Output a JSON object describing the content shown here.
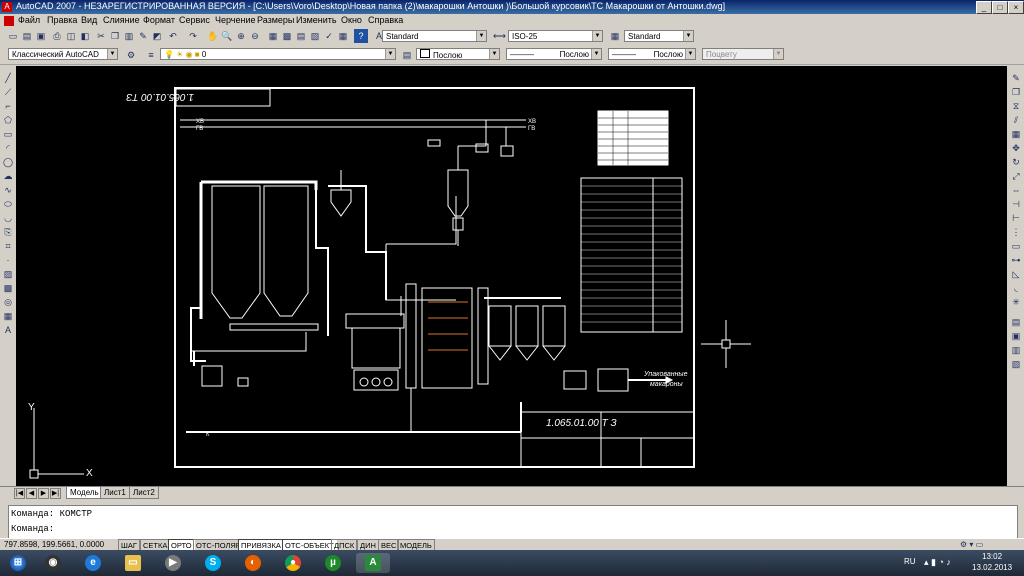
{
  "window": {
    "title": "AutoCAD 2007 - НЕЗАРЕГИСТРИРОВАННАЯ ВЕРСИЯ - [C:\\Users\\Voro\\Desktop\\Новая папка (2)\\макарошки Антошки )\\Большой курсовик\\ТС Макарошки от Антошки.dwg]",
    "minimize": "_",
    "maximize": "□",
    "close": "×"
  },
  "menu": [
    "Файл",
    "Правка",
    "Вид",
    "Слияние",
    "Формат",
    "Сервис",
    "Черчение",
    "Размеры",
    "Изменить",
    "Окно",
    "Справка"
  ],
  "toolbar": {
    "text_style": "Standard",
    "dim_style": "ISO-25",
    "table_style": "Standard",
    "workspace": "Классический AutoCAD",
    "layer": "0",
    "color": "Послою",
    "linetype": "Послою",
    "lineweight": "Послою",
    "plotstyle": "Поцвету"
  },
  "drawing": {
    "title_code_top": "1.065.01.00 ТЗ",
    "title_code_stamp": "1.065.01.00  Т З",
    "pipe_labels": [
      "ХВ",
      "ГВ",
      "К",
      "ХВ",
      "ГВ"
    ],
    "output_label_1": "Упакованные",
    "output_label_2": "макароны"
  },
  "tabs": {
    "model": "Модель",
    "sheet1": "Лист1",
    "sheet2": "Лист2"
  },
  "command": {
    "line1": "Команда: КОМСТР",
    "line2": "Команда:"
  },
  "status": {
    "coords": "797.8598, 199.5661, 0.0000",
    "buttons": [
      "ШАГ",
      "СЕТКА",
      "ОРТО",
      "ОТС-ПОЛЯР",
      "ПРИВЯЗКА",
      "ОТС-ОБЪЕКТ",
      "ДПСК",
      "ДИН",
      "ВЕС",
      "МОДЕЛЬ"
    ]
  },
  "taskbar": {
    "lang": "RU",
    "time": "13:02",
    "date": "13.02.2013"
  }
}
